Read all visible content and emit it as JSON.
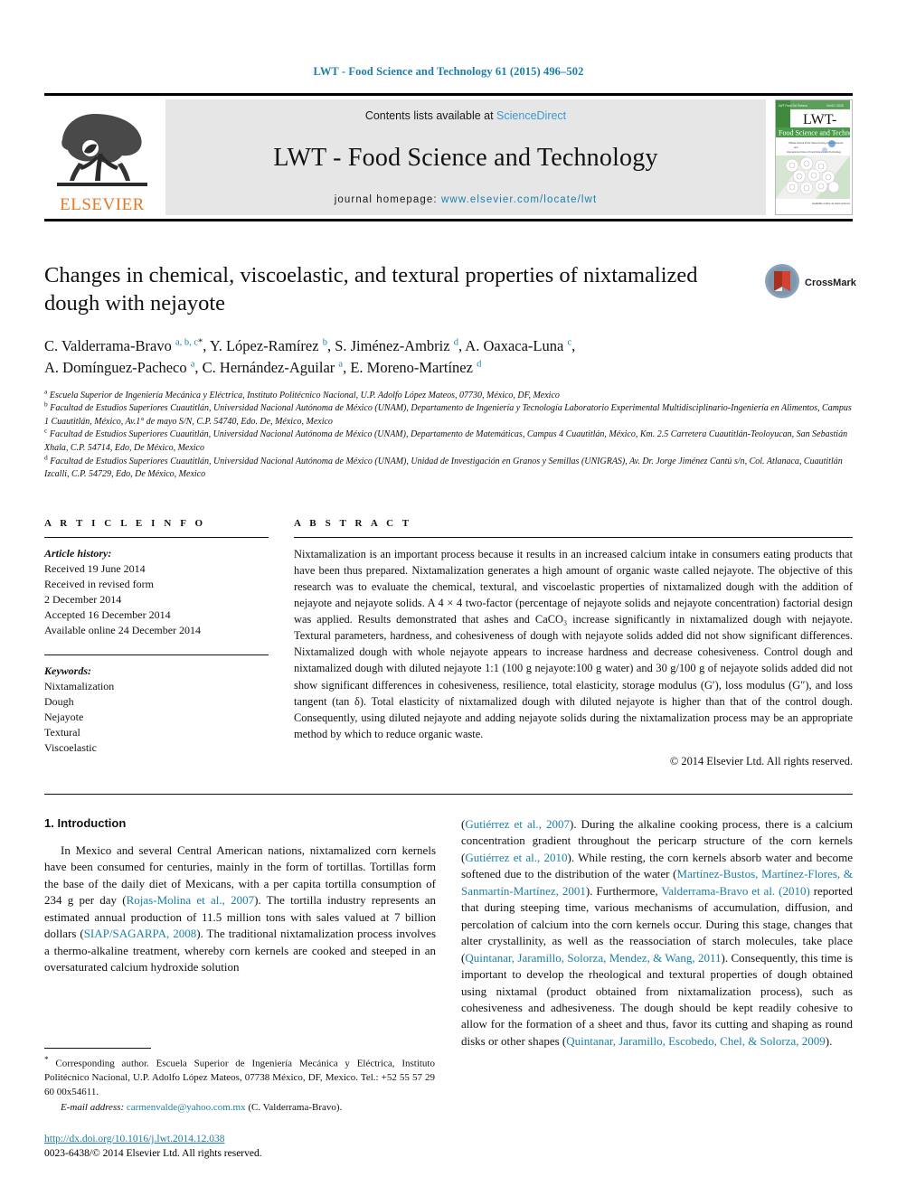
{
  "running_head": "LWT - Food Science and Technology 61 (2015) 496–502",
  "masthead": {
    "publisher_name": "ELSEVIER",
    "contents_prefix": "Contents lists available at ",
    "contents_link": "ScienceDirect",
    "journal_title": "LWT - Food Science and Technology",
    "homepage_prefix": "journal homepage: ",
    "homepage_url": "www.elsevier.com/locate/lwt",
    "cover_title_line1": "LWT-",
    "cover_title_line2": "Food Science and Technology"
  },
  "crossmark": {
    "label": "CrossMark"
  },
  "article": {
    "title": "Changes in chemical, viscoelastic, and textural properties of nixtamalized dough with nejayote",
    "authors_line1_html": "C. Valderrama-Bravo <sup>a, b, c</sup><sup class=\"star\">*</sup>, Y. López-Ramírez <sup>b</sup>, S. Jiménez-Ambriz <sup>d</sup>, A. Oaxaca-Luna <sup>c</sup>,",
    "authors_line2_html": "A. Domínguez-Pacheco <sup>a</sup>, C. Hernández-Aguilar <sup>a</sup>, E. Moreno-Martínez <sup>d</sup>",
    "affiliations": [
      "Escuela Superior de Ingeniería Mecánica y Eléctrica, Instituto Politécnico Nacional, U.P. Adolfo López Mateos, 07730, México, DF, Mexico",
      "Facultad de Estudios Superiores Cuautitlán, Universidad Nacional Autónoma de México (UNAM), Departamento de Ingeniería y Tecnología Laboratorio Experimental Multidisciplinario-Ingeniería en Alimentos, Campus 1 Cuautitlán, México, Av.1° de mayo S/N, C.P. 54740, Edo. De, México, Mexico",
      "Facultad de Estudios Superiores Cuautitlán, Universidad Nacional Autónoma de México (UNAM), Departamento de Matemáticas, Campus 4 Cuautitlán, México, Km. 2.5 Carretera Cuautitlán-Teoloyucan, San Sebastián Xhala, C.P. 54714, Edo, De México, Mexico",
      "Facultad de Estudios Superiores Cuautitlán, Universidad Nacional Autónoma de México (UNAM), Unidad de Investigación en Granos y Semillas (UNIGRAS), Av. Dr. Jorge Jiménez Cantú s/n, Col. Atlanaca, Cuautitlán Izcalli, C.P. 54729, Edo, De México, Mexico"
    ],
    "affiliation_markers": [
      "a",
      "b",
      "c",
      "d"
    ]
  },
  "article_info": {
    "heading": "A R T I C L E   I N F O",
    "history_label": "Article history:",
    "history": [
      "Received 19 June 2014",
      "Received in revised form",
      "2 December 2014",
      "Accepted 16 December 2014",
      "Available online 24 December 2014"
    ],
    "keywords_label": "Keywords:",
    "keywords": [
      "Nixtamalization",
      "Dough",
      "Nejayote",
      "Textural",
      "Viscoelastic"
    ]
  },
  "abstract": {
    "heading": "A B S T R A C T",
    "text": "Nixtamalization is an important process because it results in an increased calcium intake in consumers eating products that have been thus prepared. Nixtamalization generates a high amount of organic waste called nejayote. The objective of this research was to evaluate the chemical, textural, and viscoelastic properties of nixtamalized dough with the addition of nejayote and nejayote solids. A 4 × 4 two-factor (percentage of nejayote solids and nejayote concentration) factorial design was applied. Results demonstrated that ashes and CaCO₃ increase significantly in nixtamalized dough with nejayote. Textural parameters, hardness, and cohesiveness of dough with nejayote solids added did not show significant differences. Nixtamalized dough with whole nejayote appears to increase hardness and decrease cohesiveness. Control dough and nixtamalized dough with diluted nejayote 1:1 (100 g nejayote:100 g water) and 30 g/100 g of nejayote solids added did not show significant differences in cohesiveness, resilience, total elasticity, storage modulus (G′), loss modulus (G″), and loss tangent (tan δ). Total elasticity of nixtamalized dough with diluted nejayote is higher than that of the control dough. Consequently, using diluted nejayote and adding nejayote solids during the nixtamalization process may be an appropriate method by which to reduce organic waste.",
    "copyright": "© 2014 Elsevier Ltd. All rights reserved."
  },
  "introduction": {
    "heading": "1. Introduction",
    "left_paragraph_html": "In Mexico and several Central American nations, nixtamalized corn kernels have been consumed for centuries, mainly in the form of tortillas. Tortillas form the base of the daily diet of Mexicans, with a per capita tortilla consumption of 234 g per day (<span class=\"ref\">Rojas-Molina et al., 2007</span>). The tortilla industry represents an estimated annual production of 11.5 million tons with sales valued at 7 billion dollars (<span class=\"ref\">SIAP/SAGARPA, 2008</span>). The traditional nixtamalization process involves a thermo-alkaline treatment, whereby corn kernels are cooked and steeped in an oversaturated calcium hydroxide solution",
    "right_paragraph_html": "(<span class=\"ref\">Gutiérrez et al., 2007</span>). During the alkaline cooking process, there is a calcium concentration gradient throughout the pericarp structure of the corn kernels (<span class=\"ref\">Gutiérrez et al., 2010</span>). While resting, the corn kernels absorb water and become softened due to the distribution of the water (<span class=\"ref\">Martínez-Bustos, Martínez-Flores, &amp; Sanmartín-Martínez, 2001</span>). Furthermore, <span class=\"ref\">Valderrama-Bravo et al. (2010)</span> reported that during steeping time, various mechanisms of accumulation, diffusion, and percolation of calcium into the corn kernels occur. During this stage, changes that alter crystallinity, as well as the reassociation of starch molecules, take place (<span class=\"ref\">Quintanar, Jaramillo, Solorza, Mendez, &amp; Wang, 2011</span>). Consequently, this time is important to develop the rheological and textural properties of dough obtained using nixtamal (product obtained from nixtamalization process), such as cohesiveness and adhesiveness. The dough should be kept readily cohesive to allow for the formation of a sheet and thus, favor its cutting and shaping as round disks or other shapes (<span class=\"ref\">Quintanar, Jaramillo, Escobedo, Chel, &amp; Solorza, 2009</span>)."
  },
  "footnote": {
    "corresponding_html": "<sup>*</sup> Corresponding author. Escuela Superior de Ingeniería Mecánica y Eléctrica, Instituto Politécnico Nacional, U.P. Adolfo López Mateos, 07738 México, DF, Mexico. Tel.: +52 55 57 29 60 00x54611.",
    "email_label": "E-mail address:",
    "email": "carmenvalde@yahoo.com.mx",
    "email_owner": "(C. Valderrama-Bravo).",
    "doi_url": "http://dx.doi.org/10.1016/j.lwt.2014.12.038",
    "issn_line": "0023-6438/© 2014 Elsevier Ltd. All rights reserved."
  },
  "colors": {
    "link_blue": "#1b7fa8",
    "science_direct_blue": "#3c9bd0",
    "elsevier_orange": "#E87722",
    "masthead_grey": "#e6e6e6",
    "cover_green": "#4a9a4a",
    "crossmark_red": "#c0392b"
  }
}
